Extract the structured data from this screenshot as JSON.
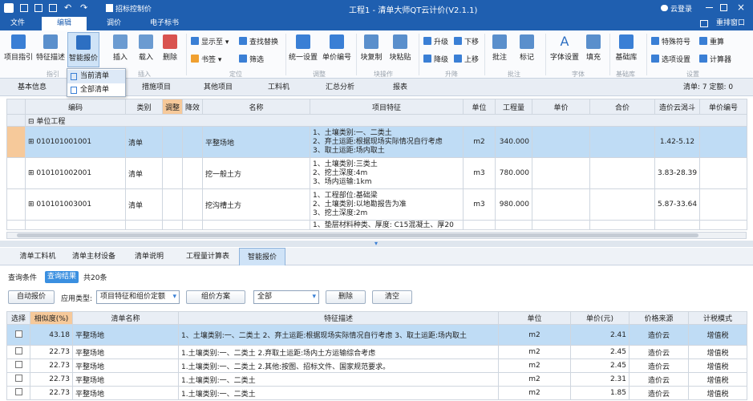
{
  "window": {
    "title": "工程1 - 清单大师QT云计价(V2.1.1)",
    "cloud_login": "云登录",
    "quick_tool": "招标控制价"
  },
  "menu": {
    "items": [
      "文件",
      "编辑",
      "调价",
      "电子标书"
    ],
    "right": "重排窗口"
  },
  "ribbon": {
    "large_buttons": [
      "项目指引",
      "特征描述",
      "智能报价",
      "插入",
      "载入",
      "删除",
      "统一设置",
      "单价编号",
      "块复制",
      "块粘贴",
      "批注",
      "标记",
      "字体设置",
      "填充",
      "基础库"
    ],
    "small_buttons": [
      "显示至",
      "查找替换",
      "书签",
      "筛选",
      "升级",
      "下移",
      "降级",
      "上移",
      "特殊符号",
      "重算",
      "选项设置",
      "计算器"
    ],
    "groups": [
      "指引",
      "插入",
      "定位",
      "调整",
      "块操作",
      "升降",
      "批注",
      "字体",
      "基础库",
      "设置"
    ]
  },
  "dropdown": {
    "items": [
      "当前清单",
      "全部清单"
    ]
  },
  "view_tabs": {
    "items": [
      "基本信息",
      "措施项目",
      "其他项目",
      "工料机",
      "汇总分析",
      "报表"
    ],
    "summary": "清单: 7 定额: 0"
  },
  "grid": {
    "headers": [
      "编码",
      "类别",
      "调整",
      "降效",
      "名称",
      "项目特征",
      "单位",
      "工程量",
      "单价",
      "合价",
      "造价云渴斗",
      "单价编号"
    ],
    "group_label": "单位工程",
    "rows": [
      {
        "code": "010101001001",
        "type": "清单",
        "name": "平整场地",
        "feature": "1、土壤类别:一、二类土\n2、弃土运距:根据现场实际情况自行考虑\n3、取土运距:场内取土",
        "unit": "m2",
        "qty": "340.000",
        "cloud": "1.42-5.12"
      },
      {
        "code": "010101002001",
        "type": "清单",
        "name": "挖一般土方",
        "feature": "1、土壤类别:三类土\n2、挖土深度:4m\n3、场内运输:1km",
        "unit": "m3",
        "qty": "780.000",
        "cloud": "3.83-28.39"
      },
      {
        "code": "010101003001",
        "type": "清单",
        "name": "挖沟槽土方",
        "feature": "1、工程部位:基础梁\n2、土壤类别:以地勘报告为准\n3、挖土深度:2m",
        "unit": "m3",
        "qty": "980.000",
        "cloud": "5.87-33.64"
      },
      {
        "code": "",
        "type": "",
        "name": "",
        "feature": "1、垫层材料种类、厚度: C15混凝土、厚20",
        "unit": "",
        "qty": "",
        "cloud": ""
      }
    ]
  },
  "lower_tabs": {
    "items": [
      "清单工料机",
      "清单主材设备",
      "清单说明",
      "工程量计算表",
      "智能报价"
    ]
  },
  "subtabs": {
    "items": [
      "查询条件",
      "查询结果"
    ],
    "count": "共20条"
  },
  "toolbar": {
    "auto_quote": "自动报价",
    "apply_type_label": "应用类型:",
    "apply_type_value": "项目特征和组价定额",
    "group_plan": "组价方案",
    "filter_value": "全部",
    "delete": "删除",
    "clear": "清空"
  },
  "results": {
    "headers": [
      "选择",
      "相似度(%)",
      "清单名称",
      "特征描述",
      "单位",
      "单价(元)",
      "价格来源",
      "计税模式"
    ],
    "rows": [
      {
        "sim": "43.18",
        "name": "平整场地",
        "desc": "1、土壤类别:一、二类土 2、弃土运距:根据现场实际情况自行考虑 3、取土运距:场内取土",
        "unit": "m2",
        "price": "2.41",
        "source": "造价云",
        "tax": "增值税"
      },
      {
        "sim": "22.73",
        "name": "平整场地",
        "desc": "1.土壤类别:一、二类土 2.弃取土运距:场内土方运输综合考虑",
        "unit": "m2",
        "price": "2.45",
        "source": "造价云",
        "tax": "增值税"
      },
      {
        "sim": "22.73",
        "name": "平整场地",
        "desc": "1.土壤类别:一、二类土 2.其他:按图、招标文件、国家规范要求。",
        "unit": "m2",
        "price": "2.45",
        "source": "造价云",
        "tax": "增值税"
      },
      {
        "sim": "22.73",
        "name": "平整场地",
        "desc": "1.土壤类别:一、二类土",
        "unit": "m2",
        "price": "2.31",
        "source": "造价云",
        "tax": "增值税"
      },
      {
        "sim": "22.73",
        "name": "平整场地",
        "desc": "1.土壤类别:一、二类土",
        "unit": "m2",
        "price": "1.85",
        "source": "造价云",
        "tax": "增值税"
      }
    ]
  },
  "colors": {
    "brand": "#1f5fb0",
    "selection": "#bfdcf5",
    "highlight": "#f6c99a"
  }
}
